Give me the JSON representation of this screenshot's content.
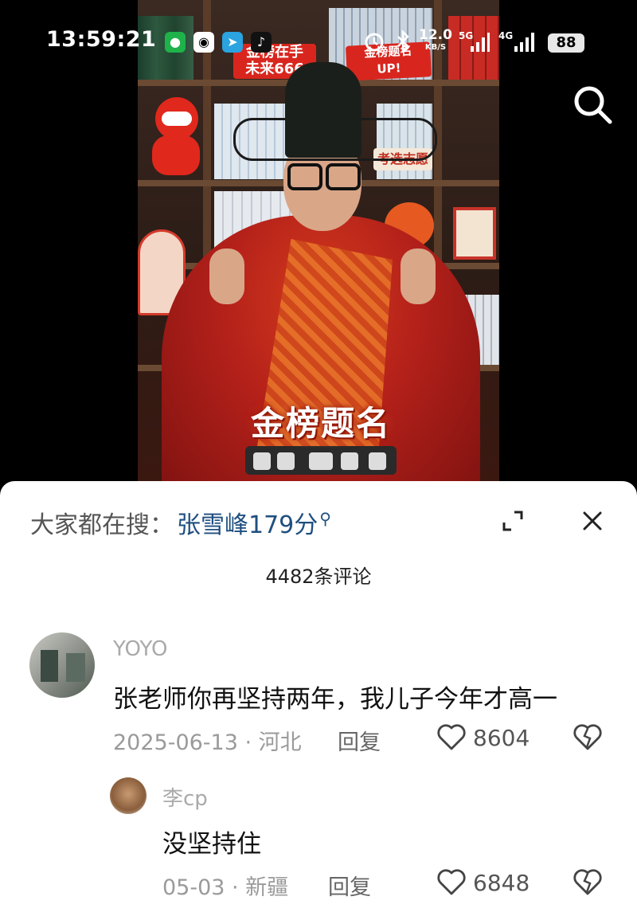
{
  "status_bar": {
    "time": "13:59:21",
    "apps": [
      "wechat-icon",
      "qq-icon",
      "telegram-icon",
      "tiktok-icon"
    ],
    "network_speed": "12.0",
    "network_speed_unit": "KB/S",
    "net1": "5G",
    "net2": "4G",
    "battery": "88"
  },
  "video": {
    "overlay_caption": "金榜题名",
    "sign1_line1": "金榜在手",
    "sign1_line2": "未来666",
    "sign2_line1": "金榜题名",
    "sign2_line2": "UP!",
    "sign3": "考选志愿"
  },
  "comments_panel": {
    "hot_search_label": "大家都在搜：",
    "hot_search_term": "张雪峰179分",
    "comment_count_label": "4482条评论",
    "comments": [
      {
        "user": "YOYO",
        "text": "张老师你再坚持两年，我儿子今年才高一",
        "meta": "2025-06-13 · 河北",
        "reply_label": "回复",
        "likes": "8604"
      },
      {
        "user": "李cp",
        "text": "没坚持住",
        "meta": "05-03 · 新疆",
        "reply_label": "回复",
        "likes": "6848"
      }
    ]
  },
  "colors": {
    "accent_link": "#1f4f80",
    "panel_bg": "#ffffff",
    "meta_gray": "#9a9a9a"
  }
}
